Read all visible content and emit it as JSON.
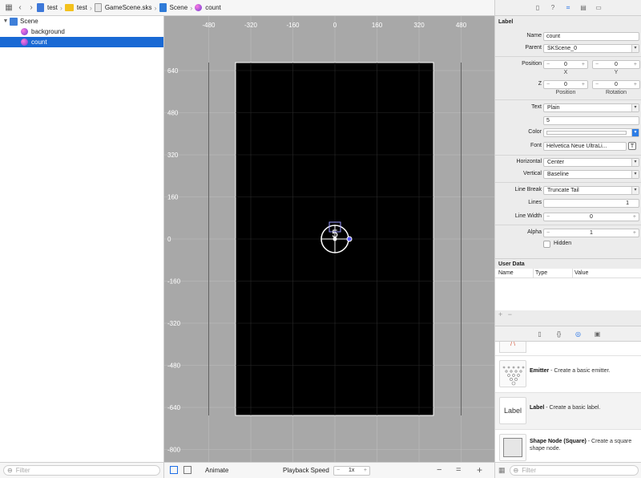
{
  "jumpbar": {
    "crumbs": [
      "test",
      "test",
      "GameScene.sks",
      "Scene",
      "count"
    ]
  },
  "navigator": {
    "items": [
      {
        "label": "Scene"
      },
      {
        "label": "background"
      },
      {
        "label": "count"
      }
    ],
    "filter_placeholder": "Filter"
  },
  "editor": {
    "x_ticks": [
      "-480",
      "-320",
      "-160",
      "0",
      "160",
      "320",
      "480"
    ],
    "y_ticks": [
      "640",
      "480",
      "320",
      "160",
      "0",
      "-160",
      "-320",
      "-480",
      "-640",
      "-800"
    ],
    "animate_label": "Animate",
    "playback_label": "Playback Speed",
    "speed_value": "1x"
  },
  "inspector": {
    "section_title": "Label",
    "name_label": "Name",
    "name_value": "count",
    "parent_label": "Parent",
    "parent_value": "SKScene_0",
    "position_label": "Position",
    "pos_x": "0",
    "pos_y": "0",
    "x_caption": "X",
    "y_caption": "Y",
    "z_label": "Z",
    "z_value": "0",
    "rotation_value": "0",
    "position_caption": "Position",
    "rotation_caption": "Rotation",
    "text_label": "Text",
    "text_mode": "Plain",
    "text_value": "5",
    "color_label": "Color",
    "font_label": "Font",
    "font_value": "Helvetica Neue UltraLi...",
    "horizontal_label": "Horizontal",
    "horizontal_value": "Center",
    "vertical_label": "Vertical",
    "vertical_value": "Baseline",
    "linebreak_label": "Line Break",
    "linebreak_value": "Truncate Tail",
    "lines_label": "Lines",
    "lines_value": "1",
    "linewidth_label": "Line Width",
    "linewidth_value": "0",
    "alpha_label": "Alpha",
    "alpha_value": "1",
    "hidden_label": "Hidden"
  },
  "userdata": {
    "title": "User Data",
    "col_name": "Name",
    "col_type": "Type",
    "col_value": "Value"
  },
  "library": {
    "items": [
      {
        "name": "Emitter",
        "desc": " - Create a basic emitter."
      },
      {
        "name": "Label",
        "desc": " - Create a basic label.",
        "thumb_text": "Label"
      },
      {
        "name": "Shape Node (Square)",
        "desc": " - Create a square shape node."
      }
    ],
    "filter_placeholder": "Filter"
  }
}
